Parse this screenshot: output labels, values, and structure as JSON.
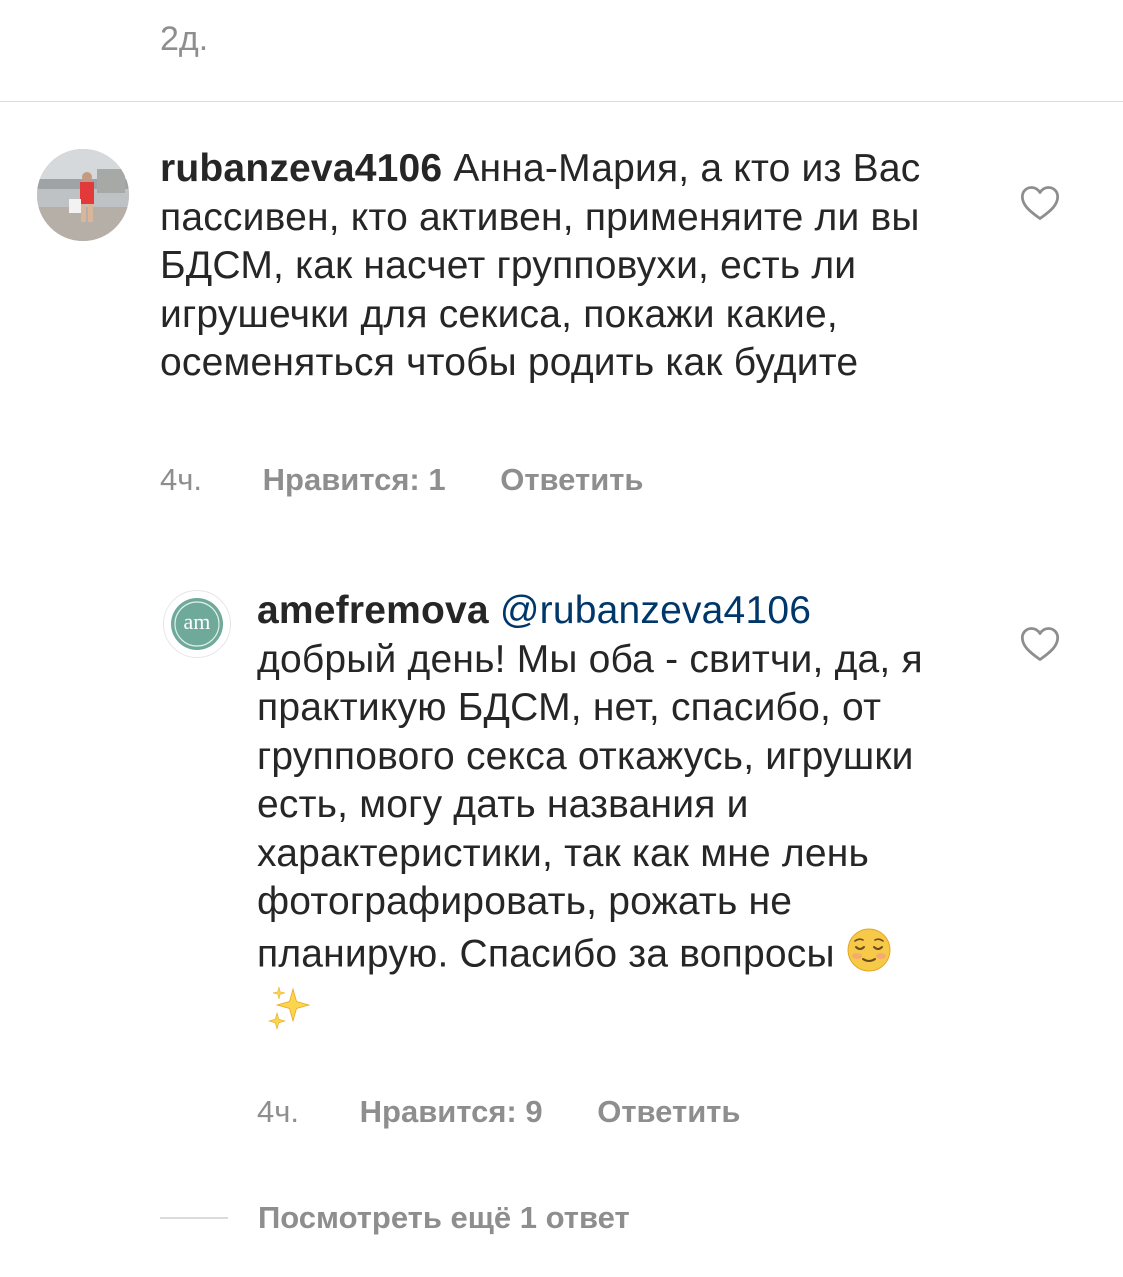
{
  "header": {
    "time": "2д."
  },
  "comments": [
    {
      "username": "rubanzeva4106",
      "mention": "",
      "text": "Анна-Мария, а кто из Вас пассивен, кто активен, применяите ли вы БДСМ, как насчет групповухи, есть ли игрушечки для секиса, покажи какие, осеменяться чтобы родить как будите",
      "time": "4ч.",
      "likes": "Нравится: 1",
      "reply": "Ответить",
      "avatar_icon": "user-photo-avatar",
      "like_icon": "heart-outline-icon"
    },
    {
      "username": "amefremova",
      "mention": "@rubanzeva4106",
      "text": "добрый день! Мы оба - свитчи, да, я практикую БДСМ, нет, спасибо, от группового секса откажусь, игрушки есть, могу дать названия и характеристики, так как мне лень фотографировать, рожать не планирую. Спасибо за вопросы",
      "emojis": [
        "relieved-face-emoji",
        "sparkles-emoji"
      ],
      "avatar_text": "am",
      "time": "4ч.",
      "likes": "Нравится: 9",
      "reply": "Ответить",
      "avatar_icon": "am-logo-avatar",
      "like_icon": "heart-outline-icon"
    }
  ],
  "view_more": {
    "label": "Посмотреть ещё 1 ответ"
  },
  "colors": {
    "text": "#262626",
    "secondary": "#8e8e8e",
    "mention": "#00376b",
    "divider": "#dbdbdb",
    "am_avatar": "#6fa99a"
  }
}
